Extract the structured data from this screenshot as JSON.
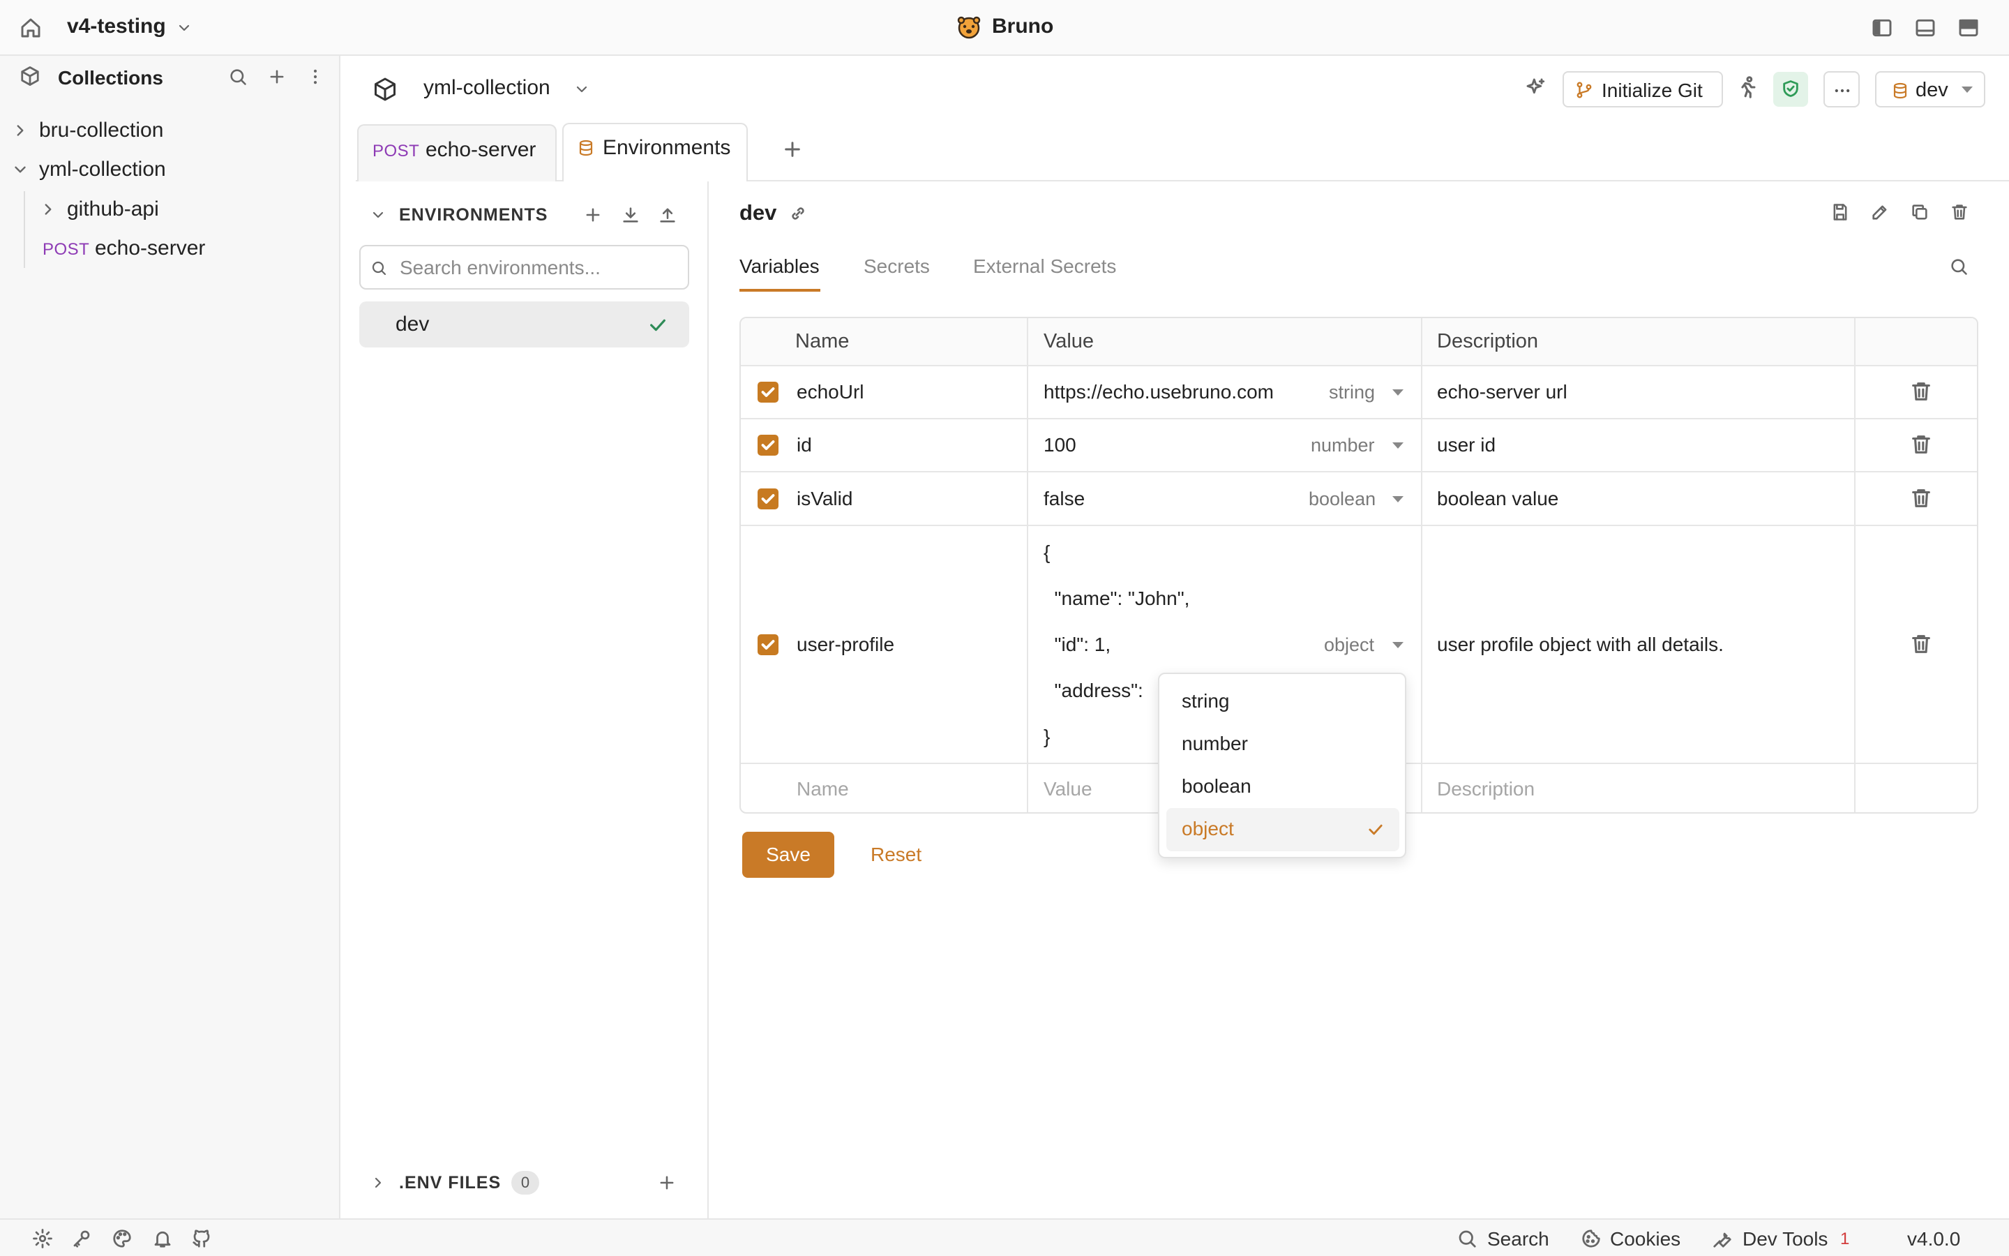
{
  "titlebar": {
    "workspace": "v4-testing",
    "app_title": "Bruno"
  },
  "sidebar": {
    "title": "Collections",
    "tree": [
      {
        "label": "bru-collection"
      },
      {
        "label": "yml-collection"
      },
      {
        "label": "github-api"
      },
      {
        "method": "POST",
        "label": "echo-server"
      }
    ]
  },
  "header": {
    "collection": "yml-collection",
    "init_git": "Initialize Git",
    "env_selector": "dev"
  },
  "tabs": [
    {
      "method": "POST",
      "label": "echo-server"
    },
    {
      "label": "Environments"
    }
  ],
  "env_panel": {
    "heading": "ENVIRONMENTS",
    "search_placeholder": "Search environments...",
    "items": [
      {
        "name": "dev"
      }
    ],
    "env_files_heading": ".ENV FILES",
    "env_files_count": "0"
  },
  "detail": {
    "name": "dev",
    "subtabs": [
      "Variables",
      "Secrets",
      "External Secrets"
    ],
    "columns": {
      "name": "Name",
      "value": "Value",
      "description": "Description"
    },
    "rows": [
      {
        "name": "echoUrl",
        "value": "https://echo.usebruno.com",
        "type": "string",
        "description": "echo-server url"
      },
      {
        "name": "id",
        "value": "100",
        "type": "number",
        "description": "user id"
      },
      {
        "name": "isValid",
        "value": "false",
        "type": "boolean",
        "description": "boolean value"
      },
      {
        "name": "user-profile",
        "value_lines": [
          "{",
          "  \"name\": \"John\",",
          "  \"id\": 1,",
          "  \"address\":",
          "}"
        ],
        "type": "object",
        "description": "user profile object with all details."
      }
    ],
    "new_row": {
      "name_placeholder": "Name",
      "value_placeholder": "Value",
      "description_placeholder": "Description"
    },
    "save": "Save",
    "reset": "Reset"
  },
  "type_dropdown": {
    "options": [
      "string",
      "number",
      "boolean",
      "object"
    ],
    "selected": "object"
  },
  "statusbar": {
    "search": "Search",
    "cookies": "Cookies",
    "devtools": "Dev Tools",
    "devtools_count": "1",
    "version": "v4.0.0"
  },
  "colors": {
    "accent": "#c97a27",
    "post_method": "#8e3bb5",
    "shield_green": "#2e9b57"
  }
}
